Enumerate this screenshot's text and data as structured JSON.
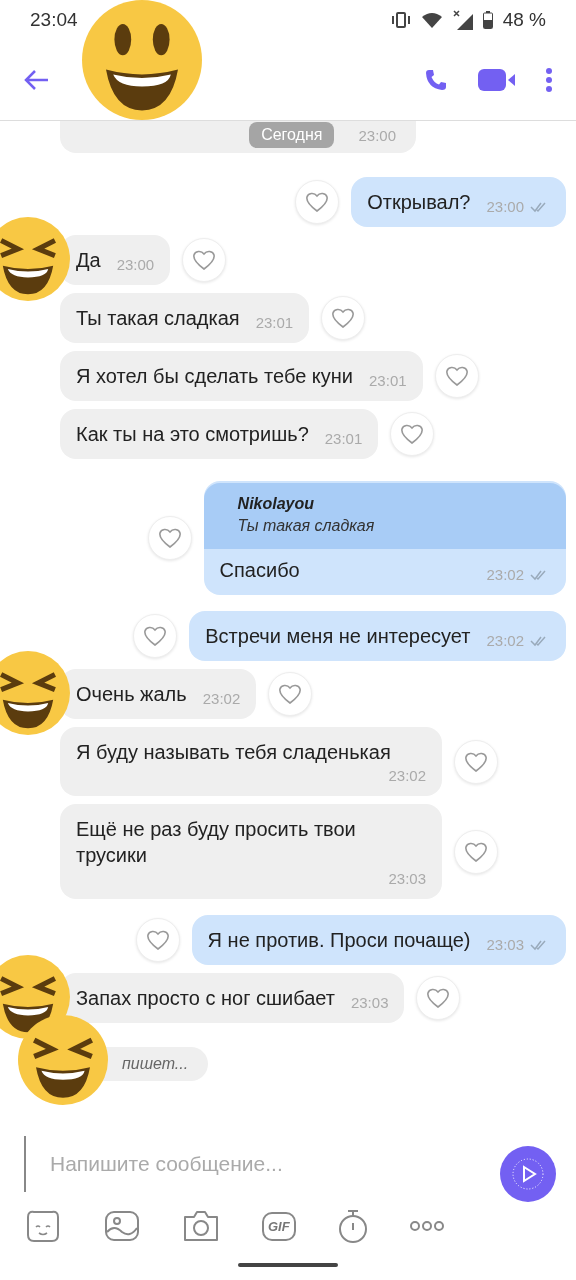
{
  "status_bar": {
    "time": "23:04",
    "battery": "48 %"
  },
  "header": {
    "avatar": true
  },
  "date_chip": {
    "label": "Сегодня",
    "time": "23:00"
  },
  "messages": [
    {
      "outgoing": true,
      "text": "Открывал?",
      "time": "23:00",
      "delivered": true
    },
    {
      "outgoing": false,
      "avatar": true,
      "text": "Да",
      "time": "23:00"
    },
    {
      "outgoing": false,
      "avatar": false,
      "text": "Ты такая сладкая",
      "time": "23:01"
    },
    {
      "outgoing": false,
      "avatar": false,
      "text": "Я хотел бы сделать тебе куни",
      "time": "23:01"
    },
    {
      "outgoing": false,
      "avatar": false,
      "text": "Как ты на это смотришь?",
      "time": "23:01"
    },
    {
      "outgoing": true,
      "reply": {
        "author": "Nikolayou",
        "text": "Ты такая сладкая"
      },
      "text": "Спасибо",
      "time": "23:02",
      "delivered": true
    },
    {
      "outgoing": true,
      "text": "Встречи меня не интересует",
      "time": "23:02",
      "delivered": true
    },
    {
      "outgoing": false,
      "avatar": true,
      "text": "Очень жаль",
      "time": "23:02"
    },
    {
      "outgoing": false,
      "avatar": false,
      "text": "Я буду называть тебя сладенькая",
      "time": "23:02"
    },
    {
      "outgoing": false,
      "avatar": false,
      "text": "Ещё не раз буду просить твои трусики",
      "time": "23:03"
    },
    {
      "outgoing": true,
      "text": "Я не против. Проси почаще)",
      "time": "23:03",
      "delivered": true
    },
    {
      "outgoing": false,
      "avatar": true,
      "text": "Запах просто с ног сшибает",
      "time": "23:03"
    }
  ],
  "typing": {
    "avatar": true,
    "text": "пишет..."
  },
  "composer": {
    "placeholder": "Напишите сообщение..."
  },
  "toolbar": {
    "gif_label": "GIF"
  }
}
